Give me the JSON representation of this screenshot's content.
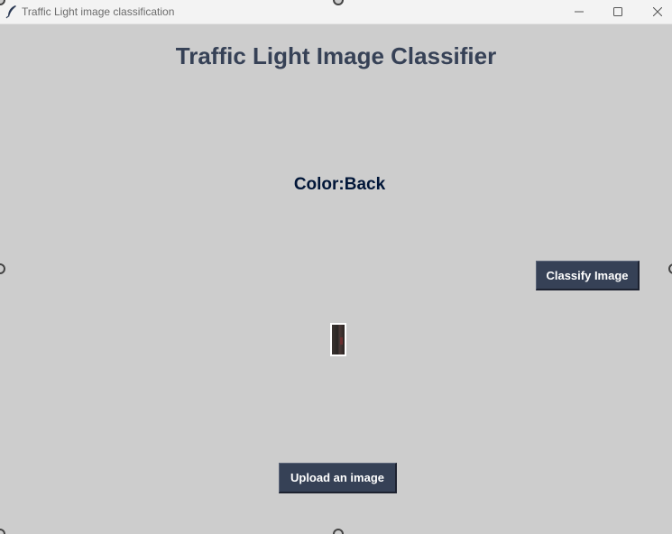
{
  "window": {
    "title": "Traffic Light image classification",
    "icon": "feather-icon",
    "controls": [
      "minimize-icon",
      "maximize-icon",
      "close-icon"
    ]
  },
  "main": {
    "heading": "Traffic Light Image Classifier",
    "result_label": "Color:Back",
    "classify_button": "Classify Image",
    "upload_button": "Upload an image",
    "image_preview": "uploaded-image-thumbnail"
  },
  "colors": {
    "background": "#cdcdcd",
    "heading_text": "#364156",
    "result_text": "#011638",
    "button_bg": "#364156",
    "button_text": "#ffffff"
  }
}
